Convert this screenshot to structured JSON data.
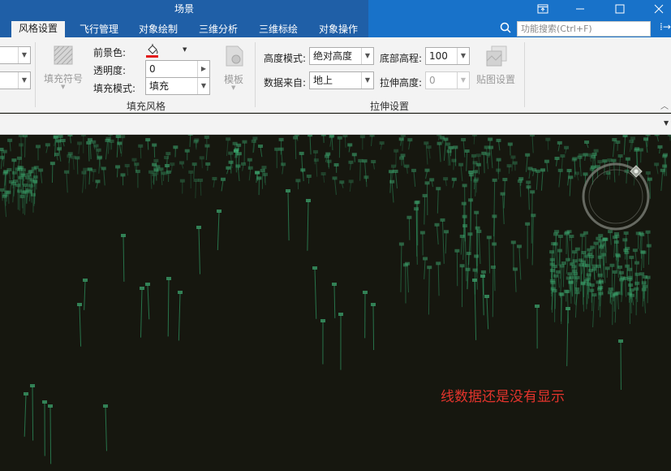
{
  "window": {
    "title": "场景",
    "controls": [
      "⊡",
      "—",
      "☐",
      "✕"
    ]
  },
  "tabs": [
    {
      "label": "风格设置",
      "active": true
    },
    {
      "label": "飞行管理"
    },
    {
      "label": "对象绘制"
    },
    {
      "label": "三维分析"
    },
    {
      "label": "三维标绘"
    },
    {
      "label": "对象操作"
    }
  ],
  "search": {
    "placeholder": "功能搜索(Ctrl+F)"
  },
  "ribbon": {
    "fill_symbol_label": "填充符号",
    "foreground_label": "前景色:",
    "transparency_label": "透明度:",
    "transparency_value": "0",
    "fill_mode_label": "填充模式:",
    "fill_mode_value": "填充",
    "template_label": "模板",
    "fill_style_group": "填充风格",
    "height_mode_label": "高度模式:",
    "height_mode_value": "绝对高度",
    "data_source_label": "数据来自:",
    "data_source_value": "地上",
    "bottom_height_label": "底部高程:",
    "bottom_height_value": "100",
    "extrude_height_label": "拉伸高度:",
    "extrude_height_value": "0",
    "texture_label": "贴图设置",
    "extrude_group": "拉伸设置"
  },
  "scene": {
    "annotation": "线数据还是没有显示",
    "accent": "#3dbb7a",
    "annotation_color": "#e3342c"
  }
}
